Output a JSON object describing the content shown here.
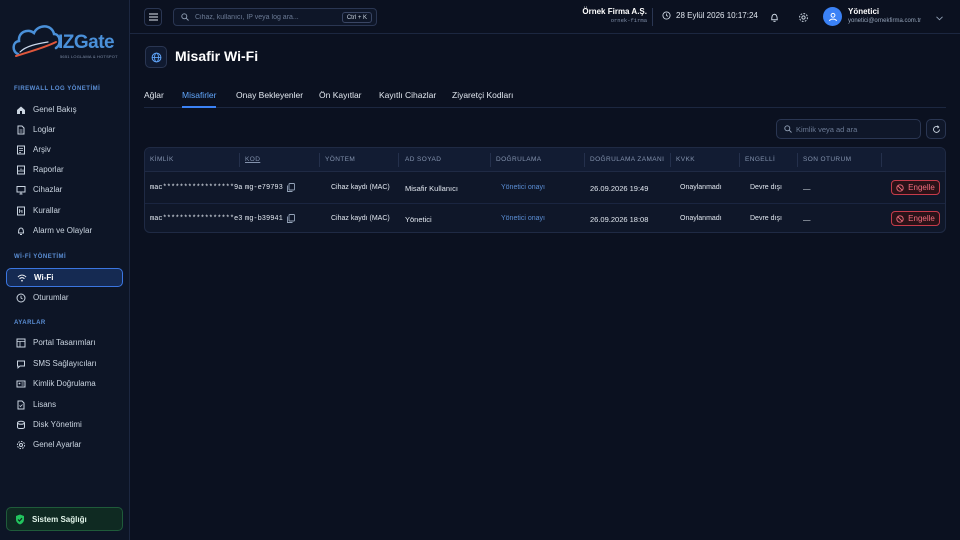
{
  "brand": {
    "logo_text": "IZGate",
    "logo_sub": "5651 LOGLAMA & HOTSPOT",
    "colors": {
      "accent": "#3b82f6",
      "background": "#0b1120",
      "sidebar": "#0d1526",
      "danger": "#f26d7d",
      "success": "#22c55e"
    }
  },
  "sidebar": {
    "sections": [
      {
        "title": "FIREWALL LOG YÖNETİMİ",
        "items": [
          {
            "label": "Genel Bakış",
            "icon": "home-icon"
          },
          {
            "label": "Loglar",
            "icon": "file-icon"
          },
          {
            "label": "Arşiv",
            "icon": "archive-icon"
          },
          {
            "label": "Raporlar",
            "icon": "report-icon"
          },
          {
            "label": "Cihazlar",
            "icon": "monitor-icon"
          },
          {
            "label": "Kurallar",
            "icon": "rules-icon"
          },
          {
            "label": "Alarm ve Olaylar",
            "icon": "bell-icon"
          }
        ]
      },
      {
        "title": "Wİ-Fİ YÖNETİMİ",
        "items": [
          {
            "label": "Wi-Fi",
            "icon": "wifi-icon",
            "active": true
          },
          {
            "label": "Oturumlar",
            "icon": "clock-icon"
          }
        ]
      },
      {
        "title": "AYARLAR",
        "items": [
          {
            "label": "Portal Tasarımları",
            "icon": "layout-icon"
          },
          {
            "label": "SMS Sağlayıcıları",
            "icon": "chat-icon"
          },
          {
            "label": "Kimlik Doğrulama",
            "icon": "id-card-icon"
          },
          {
            "label": "Lisans",
            "icon": "license-icon"
          },
          {
            "label": "Disk Yönetimi",
            "icon": "disk-icon"
          },
          {
            "label": "Genel Ayarlar",
            "icon": "gear-icon"
          }
        ]
      }
    ],
    "health_label": "Sistem Sağlığı"
  },
  "topbar": {
    "search_placeholder": "Cihaz, kullanıcı, IP veya log ara...",
    "search_shortcut": "Ctrl + K",
    "company_name": "Örnek Firma A.Ş.",
    "company_code": "ornek-firma",
    "datetime": "28 Eylül 2026 10:17:24",
    "user_name": "Yönetici",
    "user_email": "yonetici@ornekfirma.com.tr"
  },
  "page": {
    "title": "Misafir Wi-Fi",
    "tabs": [
      {
        "label": "Ağlar"
      },
      {
        "label": "Misafirler",
        "active": true
      },
      {
        "label": "Onay Bekleyenler"
      },
      {
        "label": "Ön Kayıtlar"
      },
      {
        "label": "Kayıtlı Cihazlar"
      },
      {
        "label": "Ziyaretçi Kodları"
      }
    ],
    "table_search_placeholder": "Kimlik veya ad ara"
  },
  "table": {
    "columns": [
      "KİMLİK",
      "KOD",
      "YÖNTEM",
      "AD SOYAD",
      "DOĞRULAMA",
      "DOĞRULAMA ZAMANI",
      "KVKK",
      "ENGELLİ",
      "SON OTURUM",
      ""
    ],
    "rows": [
      {
        "kimlik": "mac*****************9a",
        "kod": "mg-e79793",
        "yontem": "Cihaz kaydı (MAC)",
        "ad_soyad": "Misafir Kullanıcı",
        "dogrulama": "Yönetici onayı",
        "dogrulama_zamani": "26.09.2026 19:49",
        "kvkk": "Onaylanmadı",
        "engelli": "Devre dışı",
        "son_oturum": "—",
        "action": "Engelle"
      },
      {
        "kimlik": "mac*****************e3",
        "kod": "mg-b39941",
        "yontem": "Cihaz kaydı (MAC)",
        "ad_soyad": "Yönetici",
        "dogrulama": "Yönetici onayı",
        "dogrulama_zamani": "26.09.2026 18:08",
        "kvkk": "Onaylanmadı",
        "engelli": "Devre dışı",
        "son_oturum": "—",
        "action": "Engelle"
      }
    ]
  }
}
